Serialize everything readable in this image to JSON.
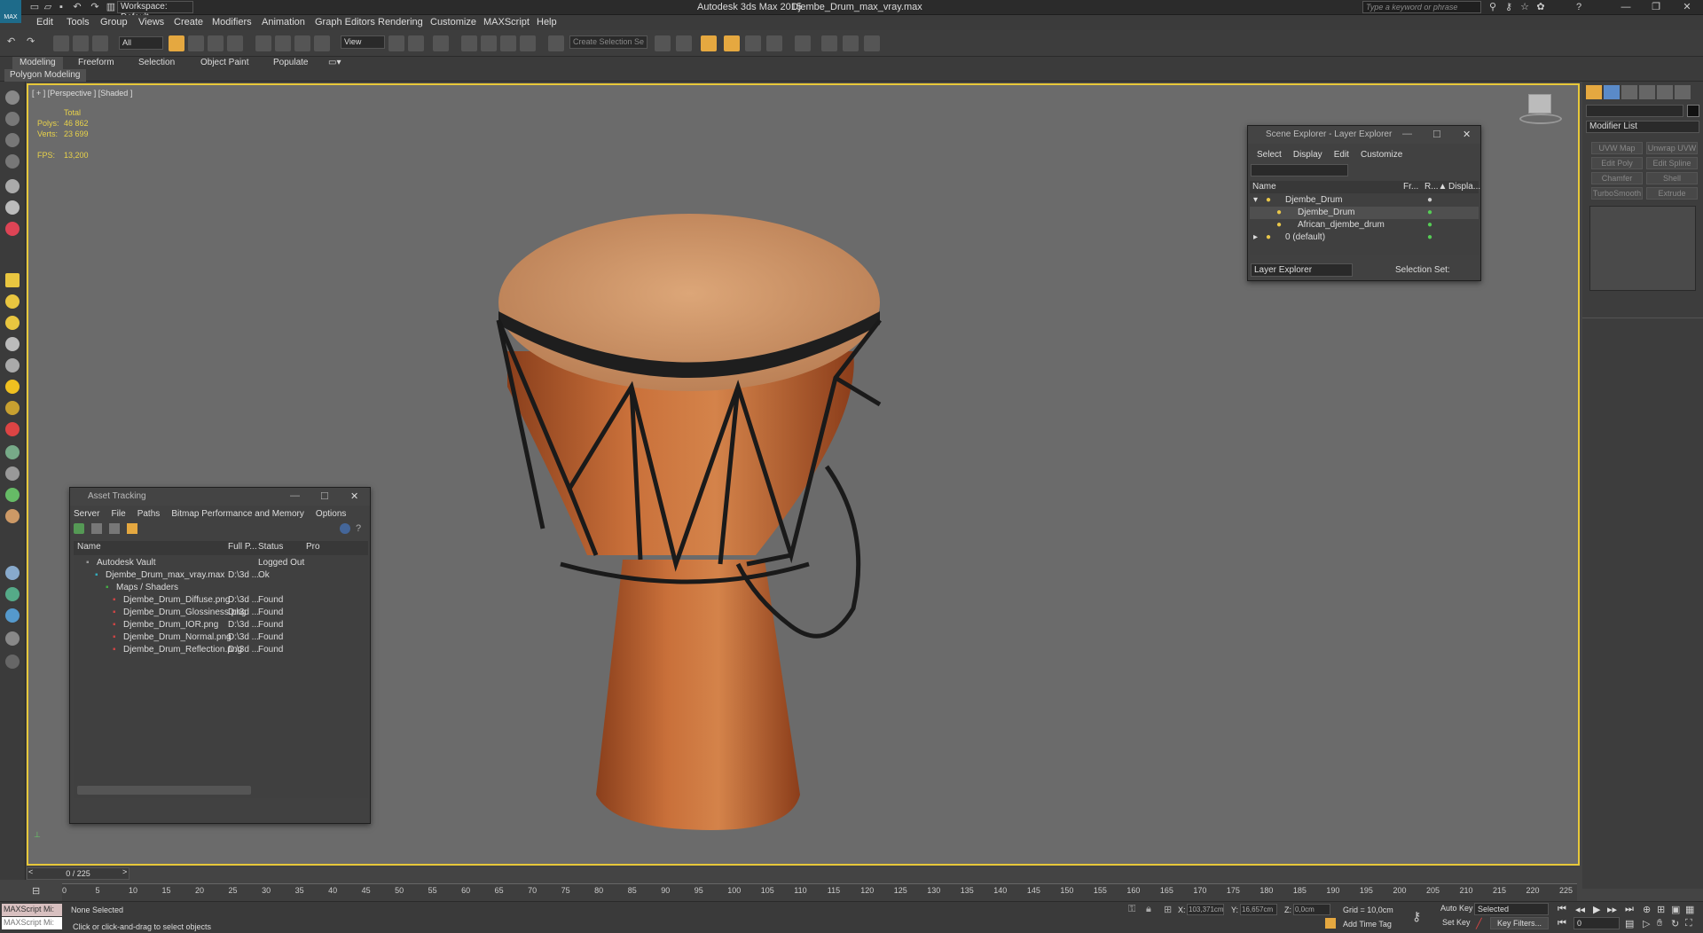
{
  "window": {
    "app_title": "Autodesk 3ds Max  2015",
    "file_title": "Djembe_Drum_max_vray.max",
    "workspace": "Workspace: Default",
    "search_placeholder": "Type a keyword or phrase",
    "logo": "MAX"
  },
  "menus": [
    "Edit",
    "Tools",
    "Group",
    "Views",
    "Create",
    "Modifiers",
    "Animation",
    "Graph Editors",
    "Rendering",
    "Customize",
    "MAXScript",
    "Help"
  ],
  "toolbar": {
    "selection_filter": "All",
    "ref_coord": "View",
    "named_selection": "Create Selection Se"
  },
  "ribbon": {
    "tabs": [
      "Modeling",
      "Freeform",
      "Selection",
      "Object Paint",
      "Populate"
    ],
    "sub_tab": "Polygon Modeling"
  },
  "viewport": {
    "label": "[ + ] [Perspective ] [Shaded ]",
    "stats": {
      "total": "Total",
      "polys_label": "Polys:",
      "polys": "46 862",
      "verts_label": "Verts:",
      "verts": "23 699",
      "fps_label": "FPS:",
      "fps": "13,200"
    }
  },
  "scene_explorer": {
    "title": "Scene Explorer - Layer Explorer",
    "menus": [
      "Select",
      "Display",
      "Edit",
      "Customize"
    ],
    "columns": [
      "Name",
      "Fr...",
      "R...▲",
      "Displa..."
    ],
    "rows": [
      {
        "name": "Djembe_Drum",
        "level": 0
      },
      {
        "name": "Djembe_Drum",
        "level": 1
      },
      {
        "name": "African_djembe_drum",
        "level": 1
      },
      {
        "name": "0 (default)",
        "level": 0
      }
    ],
    "explorer_type": "Layer Explorer",
    "selection_set": "Selection Set:"
  },
  "asset_tracking": {
    "title": "Asset Tracking",
    "menus": [
      "Server",
      "File",
      "Paths",
      "Bitmap Performance and Memory",
      "Options"
    ],
    "columns": [
      "Name",
      "Full P...",
      "Status",
      "Pro"
    ],
    "rows": [
      {
        "name": "Autodesk Vault",
        "path": "",
        "status": "Logged Out ...",
        "level": 0
      },
      {
        "name": "Djembe_Drum_max_vray.max",
        "path": "D:\\3d ...",
        "status": "Ok",
        "level": 1
      },
      {
        "name": "Maps / Shaders",
        "path": "",
        "status": "",
        "level": 2
      },
      {
        "name": "Djembe_Drum_Diffuse.png",
        "path": "D:\\3d ...",
        "status": "Found",
        "level": 3
      },
      {
        "name": "Djembe_Drum_Glossiness.png",
        "path": "D:\\3d ...",
        "status": "Found",
        "level": 3
      },
      {
        "name": "Djembe_Drum_IOR.png",
        "path": "D:\\3d ...",
        "status": "Found",
        "level": 3
      },
      {
        "name": "Djembe_Drum_Normal.png",
        "path": "D:\\3d ...",
        "status": "Found",
        "level": 3
      },
      {
        "name": "Djembe_Drum_Reflection.png",
        "path": "D:\\3d ...",
        "status": "Found",
        "level": 3
      }
    ]
  },
  "command_panel": {
    "modifier_list": "Modifier List",
    "buttons": [
      "UVW Map",
      "Unwrap UVW",
      "Edit Poly",
      "Edit Spline",
      "Chamfer",
      "Shell",
      "TurboSmooth",
      "Extrude"
    ]
  },
  "timeline": {
    "frame": "0 / 225",
    "ticks": [
      "0",
      "5",
      "10",
      "15",
      "20",
      "25",
      "30",
      "35",
      "40",
      "45",
      "50",
      "55",
      "60",
      "65",
      "70",
      "75",
      "80",
      "85",
      "90",
      "95",
      "100",
      "105",
      "110",
      "115",
      "120",
      "125",
      "130",
      "135",
      "140",
      "145",
      "150",
      "155",
      "160",
      "165",
      "170",
      "175",
      "180",
      "185",
      "190",
      "195",
      "200",
      "205",
      "210",
      "215",
      "220",
      "225"
    ]
  },
  "status": {
    "maxscript": "MAXScript Mi:",
    "selection": "None Selected",
    "prompt": "Click or click-and-drag to select objects",
    "x_label": "X:",
    "x": "103,371cm",
    "y_label": "Y:",
    "y": "16,657cm",
    "z_label": "Z:",
    "z": "0,0cm",
    "grid": "Grid = 10,0cm",
    "add_time_tag": "Add Time Tag",
    "auto_key": "Auto Key",
    "set_key": "Set Key",
    "selected": "Selected",
    "key_filters": "Key Filters...",
    "frame_field": "0"
  }
}
